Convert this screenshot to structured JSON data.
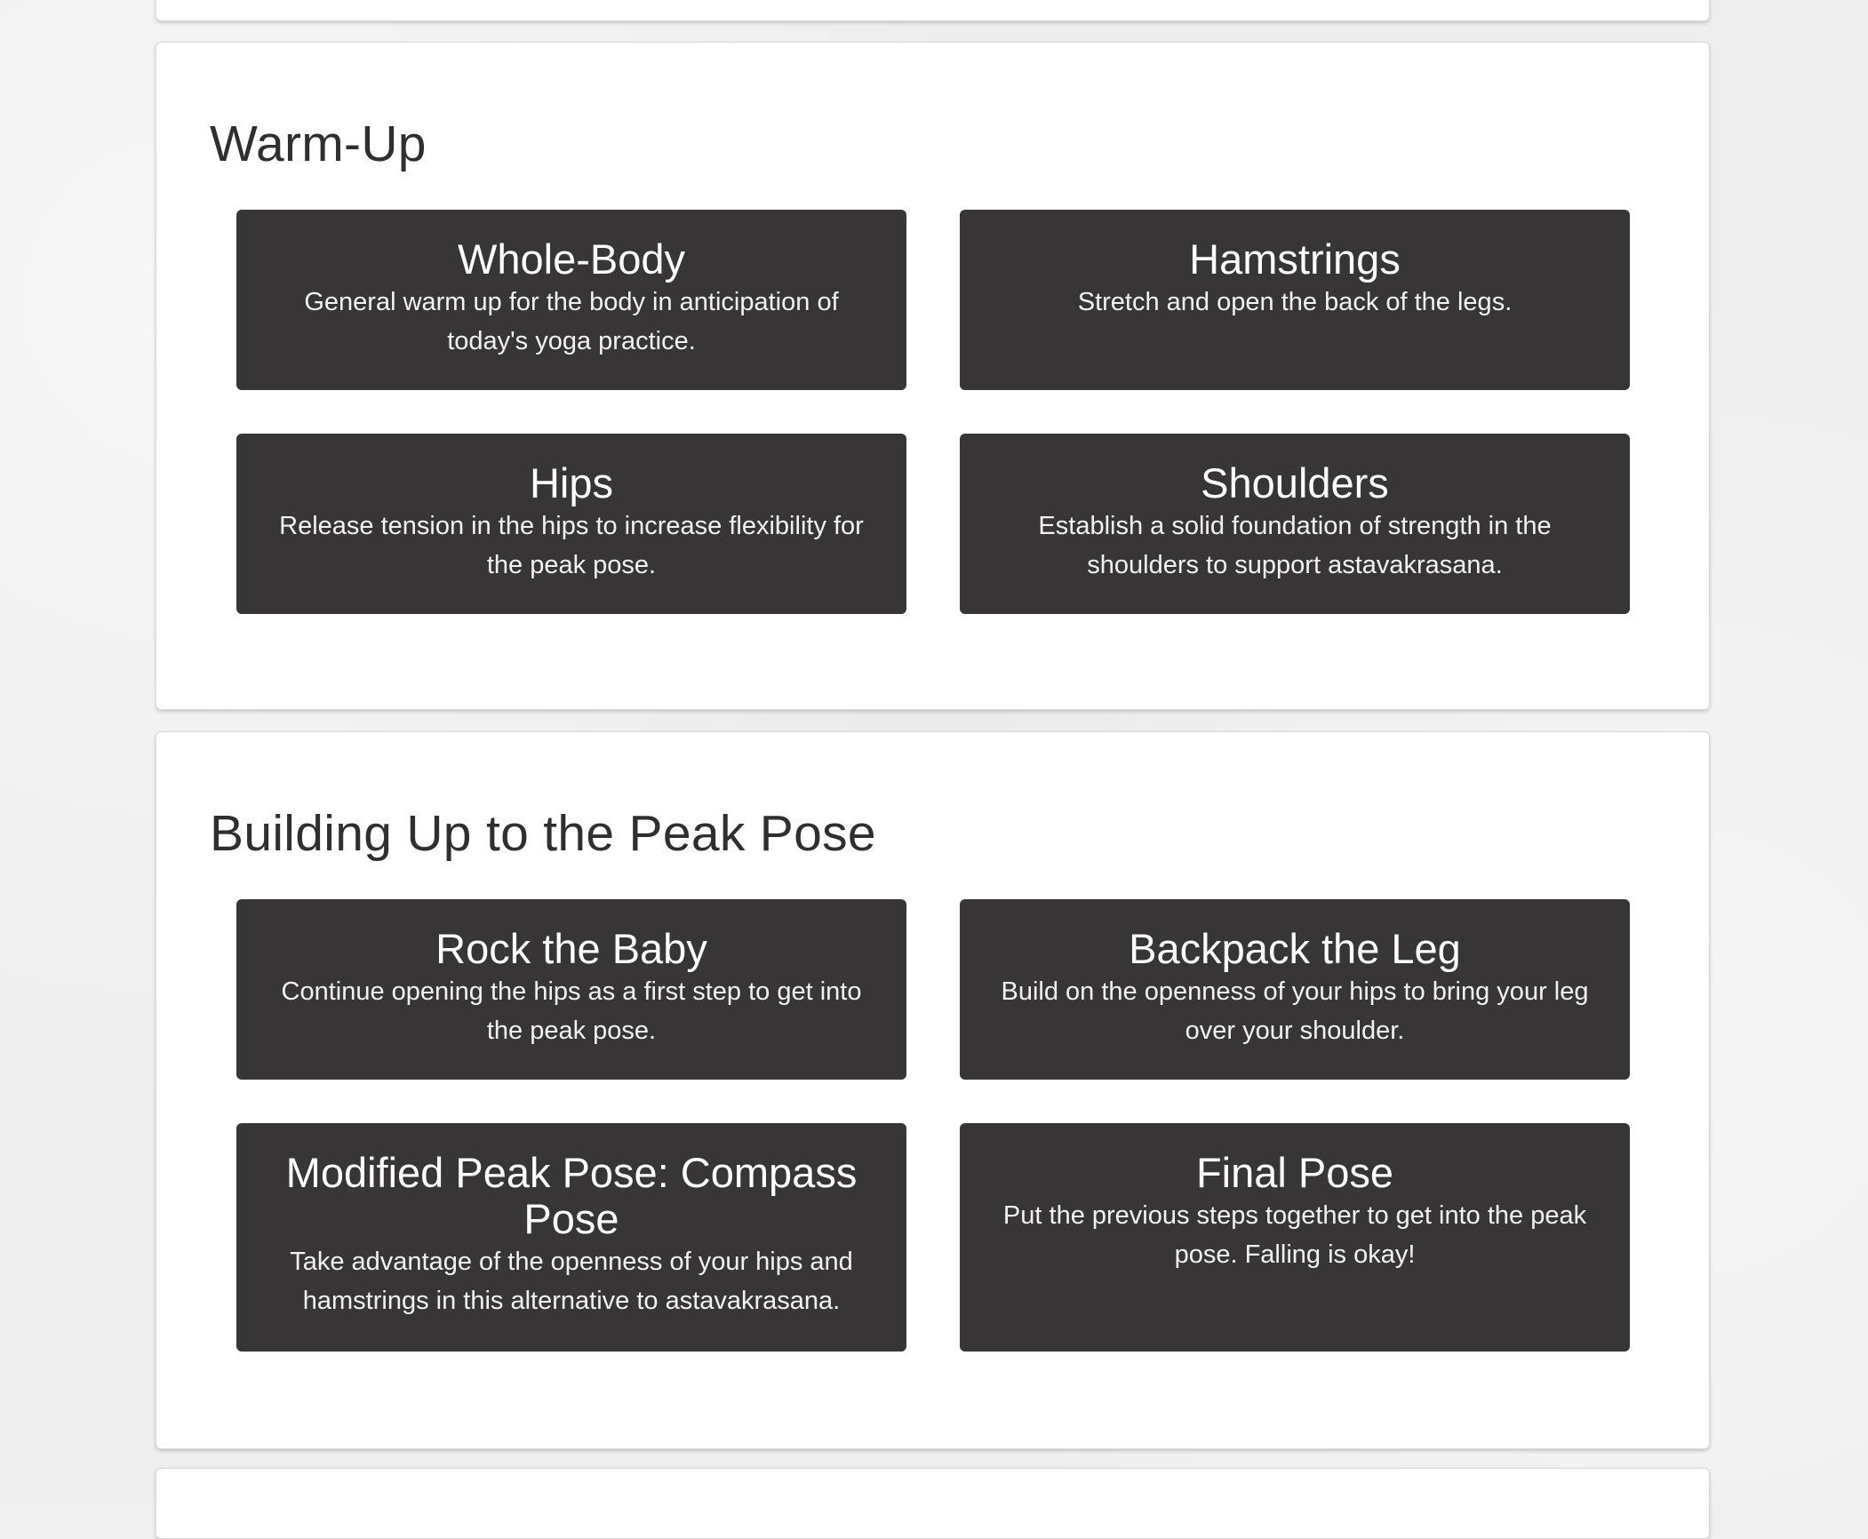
{
  "sections": [
    {
      "title": "Warm-Up",
      "cards": [
        {
          "title": "Whole-Body",
          "description": "General warm up for the body in anticipation of today's yoga practice."
        },
        {
          "title": "Hamstrings",
          "description": "Stretch and open the back of the legs."
        },
        {
          "title": "Hips",
          "description": "Release tension in the hips to increase flexibility for the peak pose."
        },
        {
          "title": "Shoulders",
          "description": "Establish a solid foundation of strength in the shoulders to support astavakrasana."
        }
      ]
    },
    {
      "title": "Building Up to the Peak Pose",
      "cards": [
        {
          "title": "Rock the Baby",
          "description": "Continue opening the hips as a first step to get into the peak pose."
        },
        {
          "title": "Backpack the Leg",
          "description": "Build on the openness of your hips to bring your leg over your shoulder."
        },
        {
          "title": "Modified Peak Pose: Compass Pose",
          "description": "Take advantage of the openness of your hips and hamstrings in this alternative to astavakrasana."
        },
        {
          "title": "Final Pose",
          "description": "Put the previous steps together to get into the peak pose. Falling is okay!"
        }
      ]
    }
  ],
  "colors": {
    "page_background": "#eeeeee",
    "panel_background": "#ffffff",
    "card_background": "#373536",
    "card_text": "#ffffff",
    "heading_text": "#2f2f2f"
  }
}
